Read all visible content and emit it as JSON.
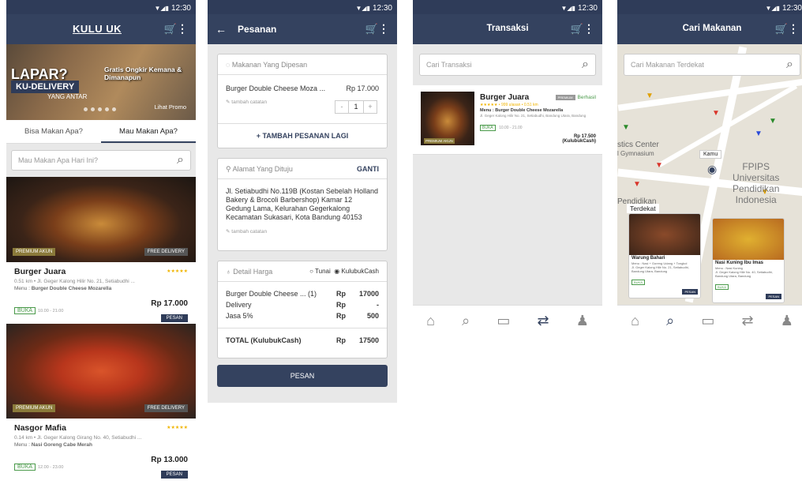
{
  "status": {
    "time": "12:30"
  },
  "s1": {
    "logo": "KULU UK",
    "banner": {
      "title": "LAPAR?",
      "brand": "KU-DELIVERY",
      "sub": "YANG ANTAR",
      "promo_text": "Gratis Ongkir Kemana & Dimanapun",
      "promo_link": "Lihat Promo"
    },
    "tabs": [
      "Bisa Makan Apa?",
      "Mau Makan Apa?"
    ],
    "search_placeholder": "Mau Makan Apa Hari Ini?",
    "items": [
      {
        "tag_left": "PREMIUM AKUN",
        "tag_right": "FREE DELIVERY",
        "name": "Burger Juara",
        "stars": "★★★★★",
        "addr": "0.51 km • Jl. Geger Kalong Hilir No. 21, Setiabudhi ...",
        "menu_label": "Menu :",
        "menu": "Burger Double Cheese Mozarella",
        "status": "BUKA",
        "hours": "10.00 - 21.00",
        "price": "Rp 17.000",
        "order": "PESAN"
      },
      {
        "tag_left": "PREMIUM AKUN",
        "tag_right": "FREE DELIVERY",
        "name": "Nasgor Mafia",
        "stars": "★★★★★",
        "addr": "0.14 km • Jl. Geger Kalong Girang No. 40, Setiabudhi ...",
        "menu_label": "Menu :",
        "menu": "Nasi Goreng Cabe Merah",
        "status": "BUKA",
        "hours": "12.00 - 23.00",
        "price": "Rp 13.000",
        "order": "PESAN"
      }
    ]
  },
  "s2": {
    "title": "Pesanan",
    "c1": {
      "header": "Makanan Yang Dipesan",
      "item": "Burger Double Cheese Moza ...",
      "price": "Rp 17.000",
      "note": "tambah catatan",
      "qty": "1",
      "minus": "-",
      "plus": "+",
      "add": "+ TAMBAH PESANAN LAGI"
    },
    "c2": {
      "header": "Alamat Yang Dituju",
      "action": "GANTI",
      "address": "Jl. Setiabudhi No.119B (Kostan Sebelah Holland Bakery & Brocoli Barbershop) Kamar 12 Gedung Lama, Kelurahan Gegerkalong Kecamatan Sukasari, Kota Bandung 40153",
      "note": "tambah catatan"
    },
    "c3": {
      "header": "Detail Harga",
      "opt1": "Tunai",
      "opt2": "KulubukCash",
      "rows": [
        {
          "label": "Burger Double Cheese ... (1)",
          "cur": "Rp",
          "val": "17000"
        },
        {
          "label": "Delivery",
          "cur": "Rp",
          "val": "-"
        },
        {
          "label": "Jasa 5%",
          "cur": "Rp",
          "val": "500"
        }
      ],
      "total_label": "TOTAL (KulubukCash)",
      "total_cur": "Rp",
      "total_val": "17500"
    },
    "button": "PESAN"
  },
  "s3": {
    "title": "Transaksi",
    "search_placeholder": "Cari Transaksi",
    "card": {
      "name": "Burger Juara",
      "badge_tag": "PREMIUM",
      "status": "Berhasil",
      "stars": "★★★★★ • 999 ulasan • 0.51 km",
      "menu": "Menu : Burger Double Cheese Mozarella",
      "addr": "Jl. Geger Kalong Hilir No. 21, Setiabudhi, Bandung Utara, Bandung",
      "buka": "BUKA",
      "hours": "10.00 - 21.00",
      "price": "Rp 17.500",
      "payment": "(KulubukCash)",
      "tag": "PREMIUM AKUN"
    }
  },
  "s4": {
    "title": "Cari Makanan",
    "search_placeholder": "Cari Makanan Terdekat",
    "labels": {
      "stics": "stics Center",
      "gym": "l Gymnasium",
      "kamu": "Kamu",
      "fpips1": "FPIPS",
      "fpips2": "Universitas",
      "fpips3": "Pendidikan",
      "fpips4": "Indonesia",
      "pend": "Pendidikan",
      "terdekat": "Terdekat",
      "univ": "Universitas"
    },
    "cards": [
      {
        "name": "Warung Bahari",
        "desc": "Menu : Nasi + Goreng Udang + Tongkol",
        "addr": "Jl. Geger Kalong Hilir No. 21, Setiabudhi, Bandung Utara, Bandung",
        "buka": "BUKA",
        "order": "PESAN"
      },
      {
        "name": "Nasi Kuning Ibu Imas",
        "desc": "Menu : Nasi Kuning",
        "addr": "Jl. Geger Kalong Hilir No. 40, Setiabudhi, Bandung Utara, Bandung",
        "buka": "BUKA",
        "order": "PESAN"
      }
    ]
  }
}
